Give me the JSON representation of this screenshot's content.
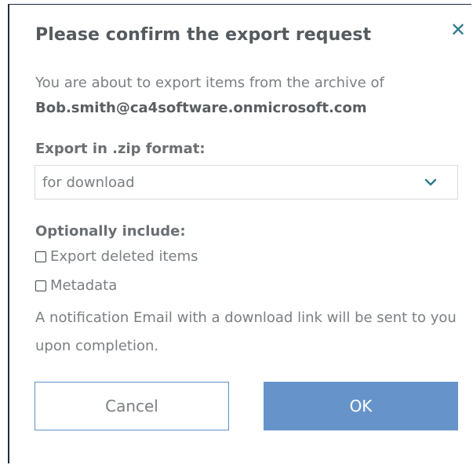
{
  "dialog": {
    "title": "Please confirm the export request",
    "close_glyph": "✕",
    "intro": "You are about to export items from the archive of",
    "email": "Bob.smith@ca4software.onmicrosoft.com",
    "format_label": "Export in .zip format:",
    "format_select": {
      "value": "for download",
      "icon": "chevron-down-icon"
    },
    "options_label": "Optionally include:",
    "options": [
      {
        "label": "Export deleted items",
        "checked": false
      },
      {
        "label": "Metadata",
        "checked": false
      }
    ],
    "notice": "A notification Email with a download link will be sent to you upon completion.",
    "cancel_label": "Cancel",
    "ok_label": "OK"
  },
  "colors": {
    "accent": "#6694ca",
    "close_icon": "#2f7a8c",
    "title_text": "#555a5e",
    "body_text": "#7b7f83"
  }
}
